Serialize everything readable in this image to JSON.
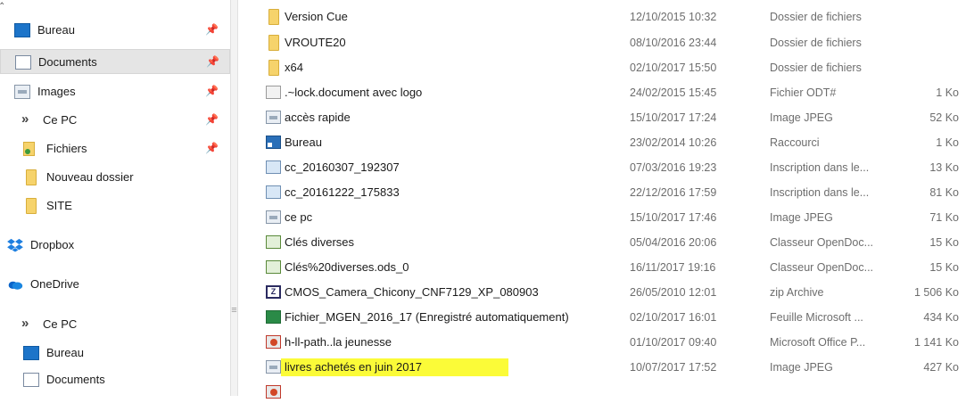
{
  "nav": {
    "items": [
      {
        "label": "Bureau",
        "icon": "desktop-icon",
        "pinned": true
      },
      {
        "label": "Documents",
        "icon": "documents-icon",
        "pinned": true,
        "selected": true
      },
      {
        "label": "Images",
        "icon": "images-icon",
        "pinned": true
      },
      {
        "label": "Ce PC",
        "icon": "chevron-icon",
        "pinned": true
      },
      {
        "label": "Fichiers",
        "icon": "folder-icon",
        "pinned": true
      },
      {
        "label": "Nouveau dossier",
        "icon": "folder-icon"
      },
      {
        "label": "SITE",
        "icon": "folder-icon"
      },
      {
        "label": "Dropbox",
        "icon": "dropbox-icon"
      },
      {
        "label": "OneDrive",
        "icon": "onedrive-icon"
      },
      {
        "label": "Ce PC",
        "icon": "chevron-icon"
      },
      {
        "label": "Bureau",
        "icon": "desktop-icon"
      },
      {
        "label": "Documents",
        "icon": "documents-icon"
      }
    ],
    "pin_glyph": "📌",
    "chevron_glyph": "»"
  },
  "splitter": {
    "grip": "≡"
  },
  "files": [
    {
      "name": "Version Cue",
      "date": "12/10/2015 10:32",
      "type": "Dossier de fichiers",
      "size": "",
      "icon": "folder-icon"
    },
    {
      "name": "VROUTE20",
      "date": "08/10/2016 23:44",
      "type": "Dossier de fichiers",
      "size": "",
      "icon": "folder-icon"
    },
    {
      "name": "x64",
      "date": "02/10/2017 15:50",
      "type": "Dossier de fichiers",
      "size": "",
      "icon": "folder-icon"
    },
    {
      "name": ".~lock.document avec logo",
      "date": "24/02/2015 15:45",
      "type": "Fichier ODT#",
      "size": "1 Ko",
      "icon": "odt-lock-icon"
    },
    {
      "name": "accès rapide",
      "date": "15/10/2017 17:24",
      "type": "Image JPEG",
      "size": "52 Ko",
      "icon": "image-icon"
    },
    {
      "name": "Bureau",
      "date": "23/02/2014 10:26",
      "type": "Raccourci",
      "size": "1 Ko",
      "icon": "shortcut-icon"
    },
    {
      "name": "cc_20160307_192307",
      "date": "07/03/2016 19:23",
      "type": "Inscription dans le...",
      "size": "13 Ko",
      "icon": "registry-icon"
    },
    {
      "name": "cc_20161222_175833",
      "date": "22/12/2016 17:59",
      "type": "Inscription dans le...",
      "size": "81 Ko",
      "icon": "registry-icon"
    },
    {
      "name": "ce pc",
      "date": "15/10/2017 17:46",
      "type": "Image JPEG",
      "size": "71 Ko",
      "icon": "image-icon"
    },
    {
      "name": "Clés diverses",
      "date": "05/04/2016 20:06",
      "type": "Classeur OpenDoc...",
      "size": "15 Ko",
      "icon": "spreadsheet-icon"
    },
    {
      "name": "Clés%20diverses.ods_0",
      "date": "16/11/2017 19:16",
      "type": "Classeur OpenDoc...",
      "size": "15 Ko",
      "icon": "spreadsheet-icon"
    },
    {
      "name": "CMOS_Camera_Chicony_CNF7129_XP_080903",
      "date": "26/05/2010 12:01",
      "type": "zip Archive",
      "size": "1 506 Ko",
      "icon": "zip-icon"
    },
    {
      "name": "Fichier_MGEN_2016_17 (Enregistré automatiquement)",
      "date": "02/10/2017 16:01",
      "type": "Feuille Microsoft ...",
      "size": "434 Ko",
      "icon": "excel-icon"
    },
    {
      "name": "h-ll-path..la jeunesse",
      "date": "01/10/2017 09:40",
      "type": "Microsoft Office P...",
      "size": "1 141 Ko",
      "icon": "powerpoint-icon"
    },
    {
      "name": "livres achetés en juin 2017",
      "date": "10/07/2017 17:52",
      "type": "Image JPEG",
      "size": "427 Ko",
      "icon": "image-icon",
      "highlighted": true
    }
  ],
  "colors": {
    "highlight": "#fbfb38",
    "selection": "#e5e5e5",
    "accent": "#1c74c9"
  }
}
